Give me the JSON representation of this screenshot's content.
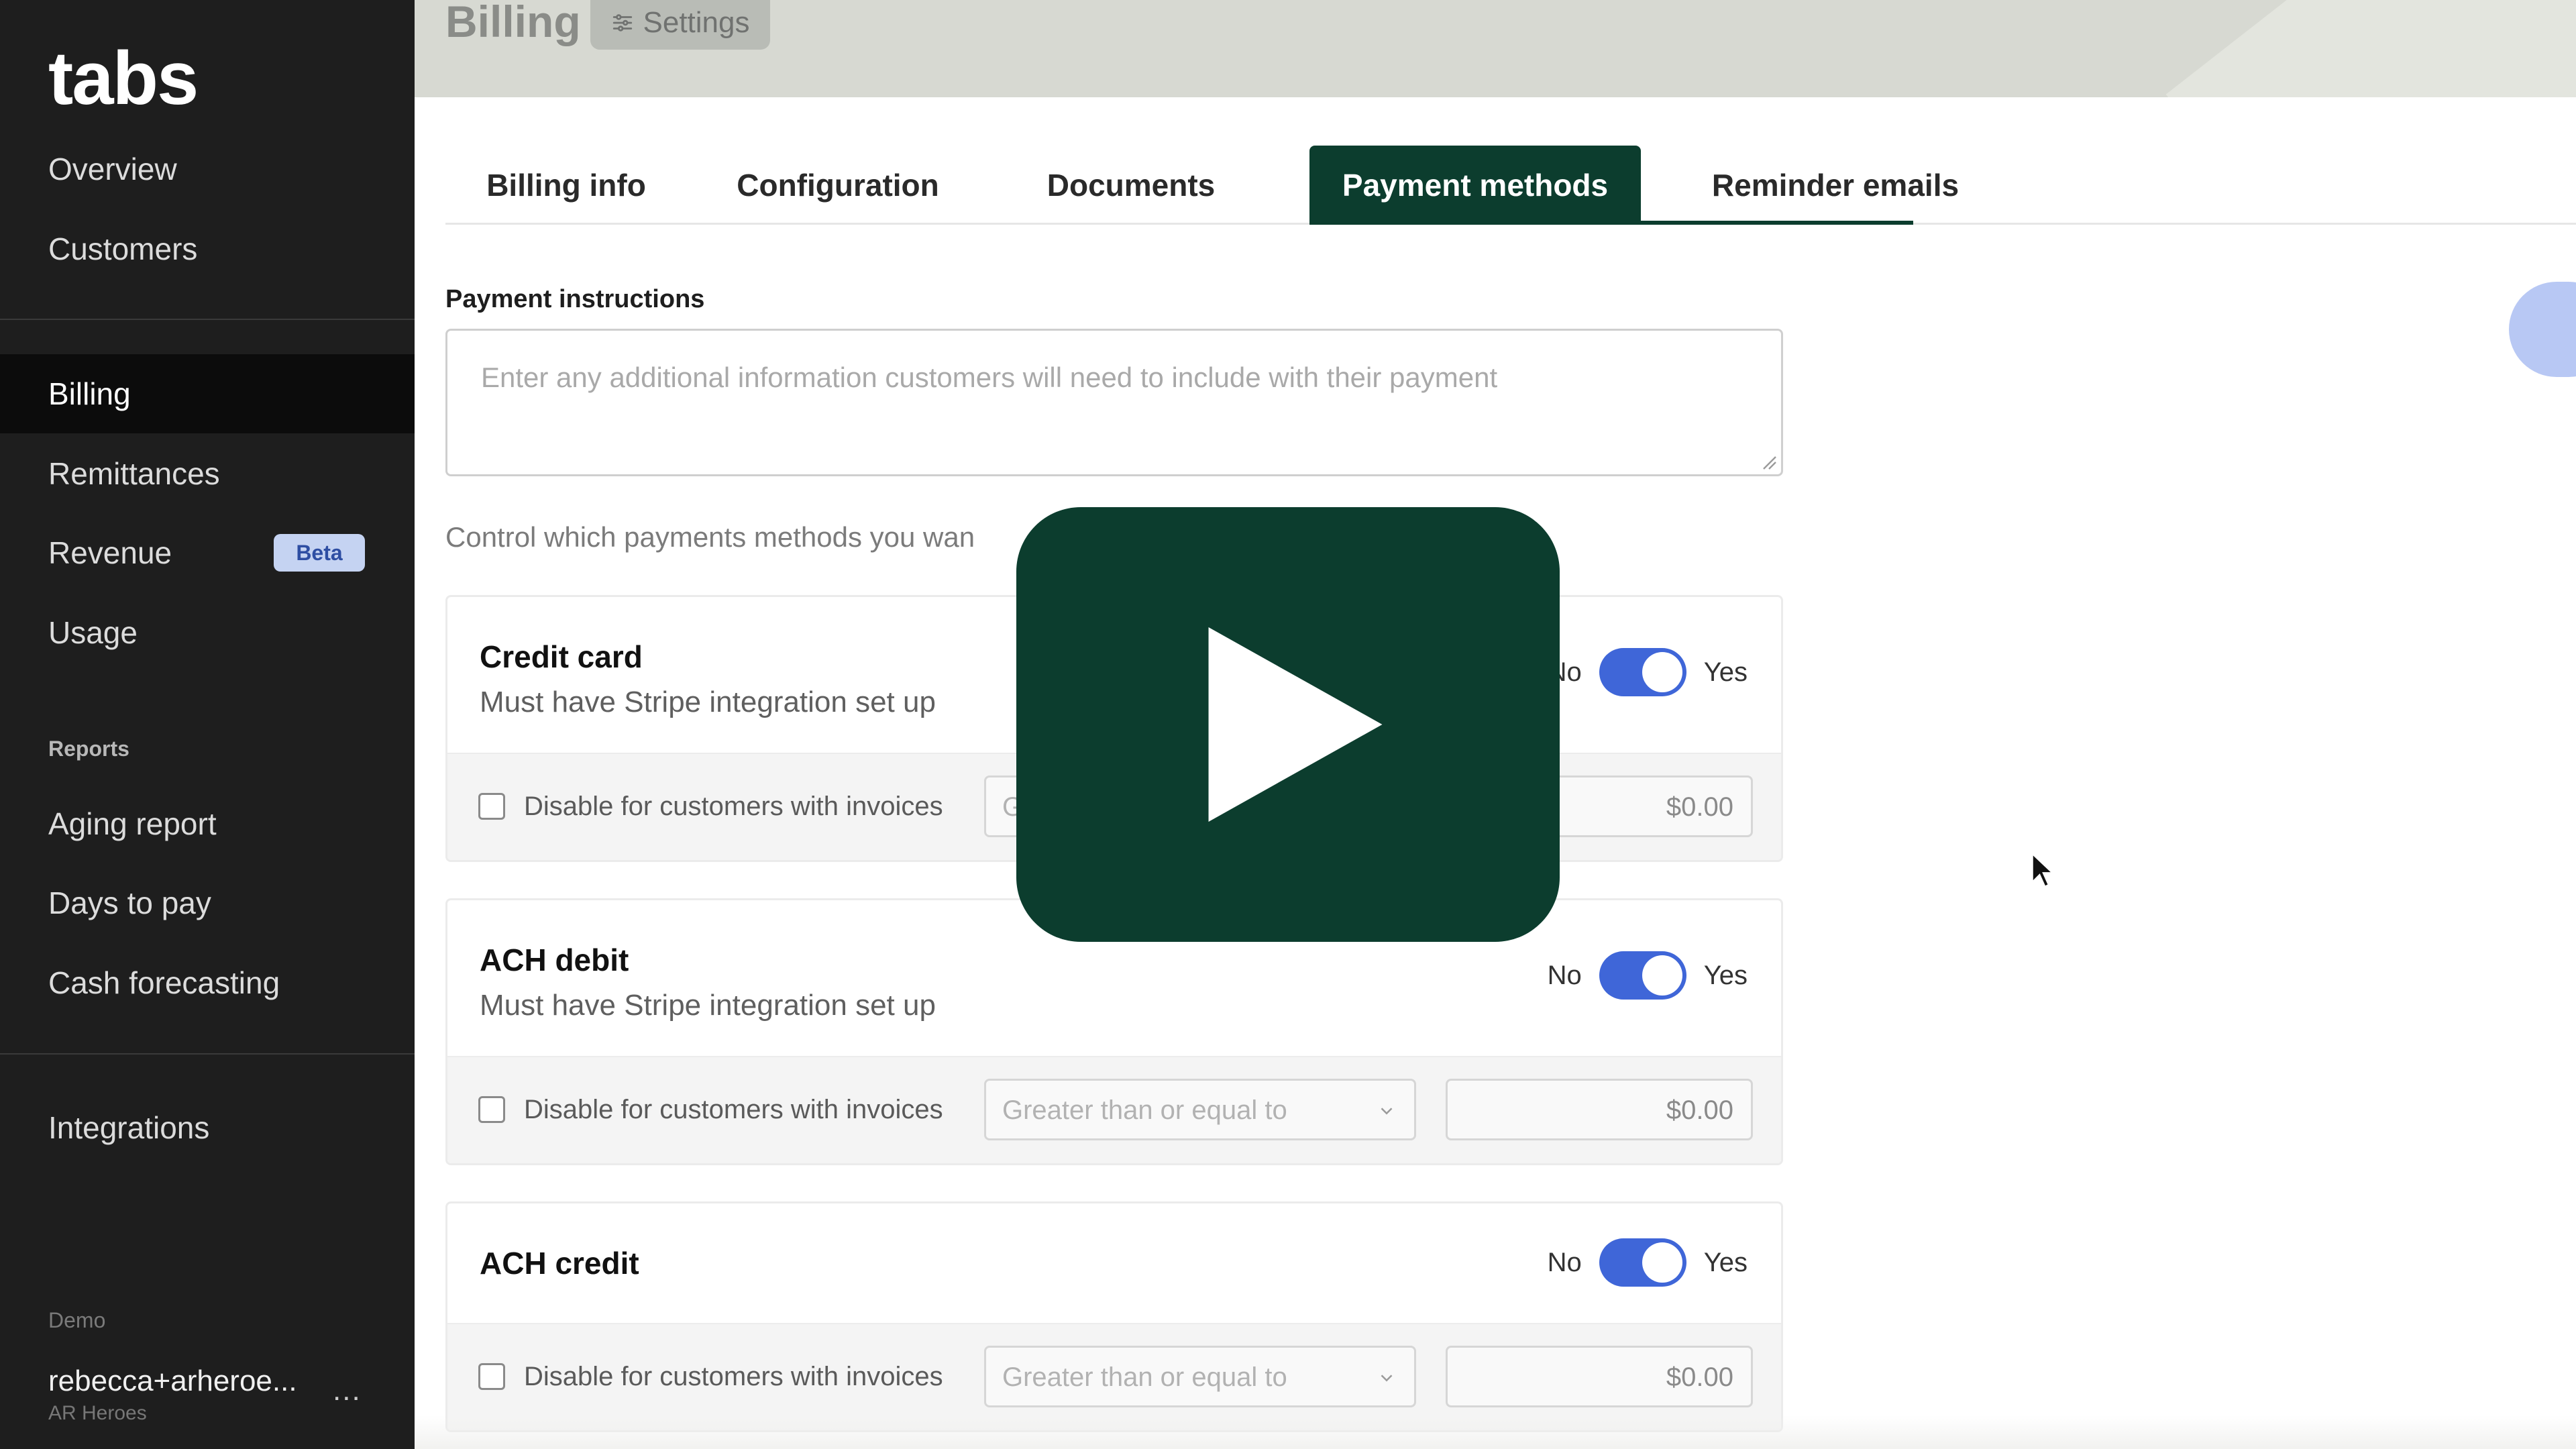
{
  "sidebar": {
    "logo": "tabs",
    "nav": [
      {
        "label": "Overview"
      },
      {
        "label": "Customers"
      },
      {
        "label": "Billing"
      },
      {
        "label": "Remittances"
      },
      {
        "label": "Revenue",
        "badge": "Beta"
      },
      {
        "label": "Usage"
      }
    ],
    "reports_label": "Reports",
    "reports": [
      {
        "label": "Aging report"
      },
      {
        "label": "Days to pay"
      },
      {
        "label": "Cash forecasting"
      }
    ],
    "integrations_label": "Integrations",
    "account": {
      "section_label": "Demo",
      "email": "rebecca+arheroe...",
      "org": "AR Heroes",
      "more": "..."
    }
  },
  "header": {
    "title": "Billing",
    "settings_label": "Settings"
  },
  "tabs": [
    {
      "label": "Billing info"
    },
    {
      "label": "Configuration"
    },
    {
      "label": "Documents"
    },
    {
      "label": "Payment methods",
      "active": true
    },
    {
      "label": "Reminder emails"
    }
  ],
  "payment_instructions": {
    "label": "Payment instructions",
    "placeholder": "Enter any additional information customers will need to include with their payment"
  },
  "control_text": "Control which payments methods you wan",
  "methods": [
    {
      "title": "Credit card",
      "subtitle": "Must have Stripe integration set up",
      "toggle_no": "No",
      "toggle_yes": "Yes",
      "enabled": true,
      "disable_label": "Disable for customers with invoices",
      "condition_placeholder": "G",
      "amount": "$0.00"
    },
    {
      "title": "ACH debit",
      "subtitle": "Must have Stripe integration set up",
      "toggle_no": "No",
      "toggle_yes": "Yes",
      "enabled": true,
      "disable_label": "Disable for customers with invoices",
      "condition_placeholder": "Greater than or equal to",
      "amount": "$0.00"
    },
    {
      "title": "ACH credit",
      "toggle_no": "No",
      "toggle_yes": "Yes",
      "enabled": true,
      "disable_label": "Disable for customers with invoices",
      "condition_placeholder": "Greater than or equal to",
      "amount": "$0.00"
    }
  ],
  "colors": {
    "sidebar_bg": "#1e1e1e",
    "accent_green": "#0c3d2e",
    "toggle_blue": "#3f66d8",
    "beta_badge_bg": "#c5d3f2"
  },
  "icons": {
    "settings": "sliders-icon",
    "play": "play-icon",
    "cursor": "cursor-arrow-icon"
  }
}
